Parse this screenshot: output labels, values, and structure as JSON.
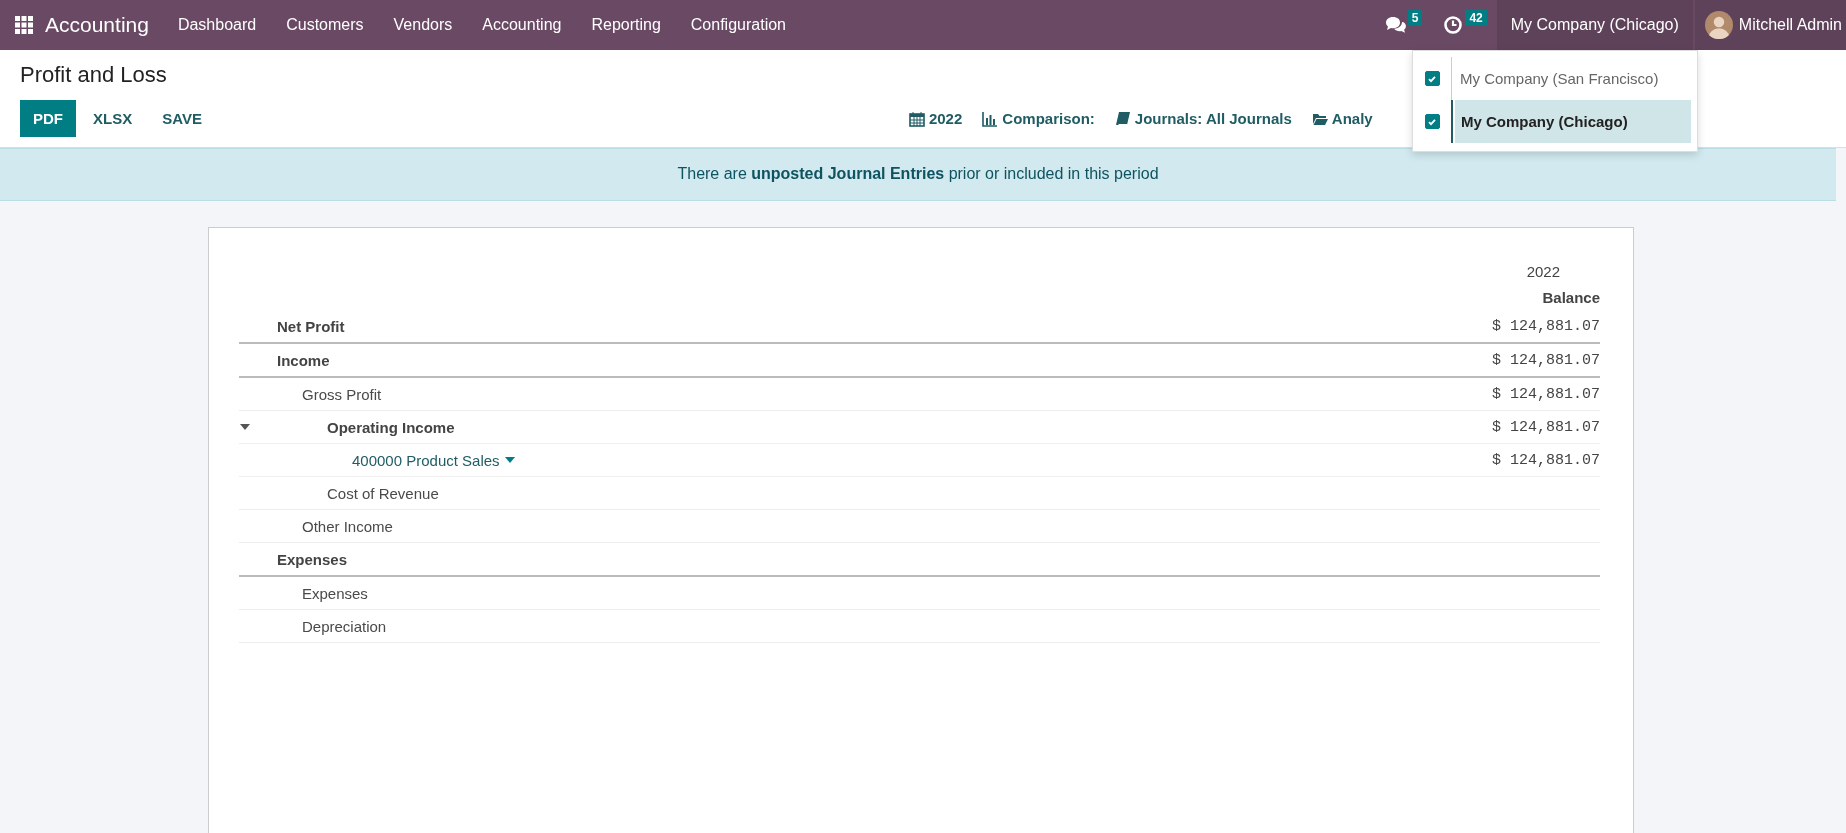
{
  "navbar": {
    "app_name": "Accounting",
    "menu": [
      "Dashboard",
      "Customers",
      "Vendors",
      "Accounting",
      "Reporting",
      "Configuration"
    ],
    "messages_count": "5",
    "activities_count": "42",
    "company": "My Company (Chicago)",
    "user": "Mitchell Admin"
  },
  "company_menu": [
    {
      "label": "My Company (San Francisco)",
      "checked": true,
      "selected": false
    },
    {
      "label": "My Company (Chicago)",
      "checked": true,
      "selected": true
    }
  ],
  "page": {
    "title": "Profit and Loss",
    "buttons": [
      {
        "label": "PDF",
        "kind": "primary"
      },
      {
        "label": "XLSX",
        "kind": "link"
      },
      {
        "label": "SAVE",
        "kind": "link"
      }
    ],
    "filters": [
      {
        "label": "2022",
        "kind": "calendar"
      },
      {
        "label": "Comparison:",
        "kind": "chart"
      },
      {
        "label": "Journals: All Journals",
        "kind": "book"
      },
      {
        "label": "Analy",
        "kind": "folder"
      }
    ]
  },
  "alert": "There are **unposted Journal Entries** prior or included in this period",
  "report": {
    "period": "2022",
    "column": "Balance",
    "rows": [
      {
        "label": "Net Profit",
        "kind": "total",
        "amount": "$ 124,881.07"
      },
      {
        "label": "Income",
        "kind": "total",
        "amount": "$ 124,881.07",
        "children": [
          {
            "label": "Gross Profit",
            "kind": "line",
            "amount": "$ 124,881.07",
            "children": [
              {
                "label": "Operating Income",
                "kind": "group",
                "expanded": true,
                "amount": "$ 124,881.07",
                "children": [
                  {
                    "label": "400000 Product Sales",
                    "kind": "account",
                    "amount": "$ 124,881.07"
                  }
                ]
              },
              {
                "label": "Cost of Revenue",
                "kind": "line"
              }
            ]
          },
          {
            "label": "Other Income",
            "kind": "line"
          }
        ]
      },
      {
        "label": "Expenses",
        "kind": "total",
        "children": [
          {
            "label": "Expenses",
            "kind": "line"
          },
          {
            "label": "Depreciation",
            "kind": "line"
          }
        ]
      }
    ]
  }
}
